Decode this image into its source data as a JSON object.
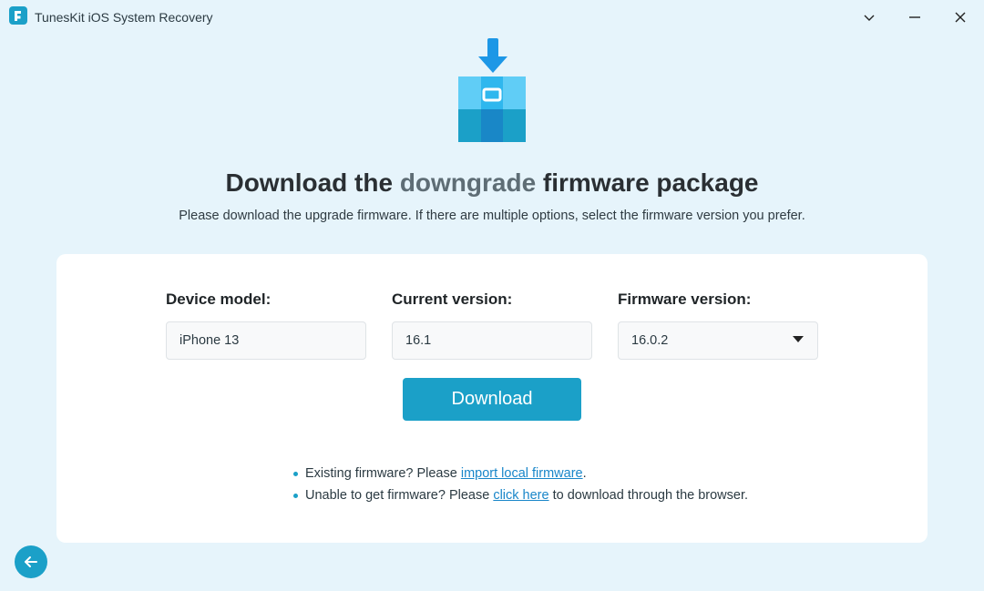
{
  "titlebar": {
    "title": "TunesKit iOS System Recovery"
  },
  "hero": {
    "headline_pre": "Download the ",
    "headline_emph": "downgrade",
    "headline_post": " firmware package",
    "subhead": "Please download the upgrade firmware. If there are multiple options, select the firmware version you prefer."
  },
  "form": {
    "device_model_label": "Device model:",
    "device_model_value": "iPhone 13",
    "current_version_label": "Current version:",
    "current_version_value": "16.1",
    "firmware_version_label": "Firmware version:",
    "firmware_version_value": "16.0.2",
    "download_label": "Download"
  },
  "notes": {
    "line1_pre": "Existing firmware? Please ",
    "line1_link": "import local firmware",
    "line1_post": ".",
    "line2_pre": "Unable to get firmware? Please ",
    "line2_link": "click here",
    "line2_post": " to download through the browser."
  },
  "colors": {
    "accent": "#1ba0c8",
    "link": "#1986c9",
    "bg": "#e6f4fb"
  }
}
